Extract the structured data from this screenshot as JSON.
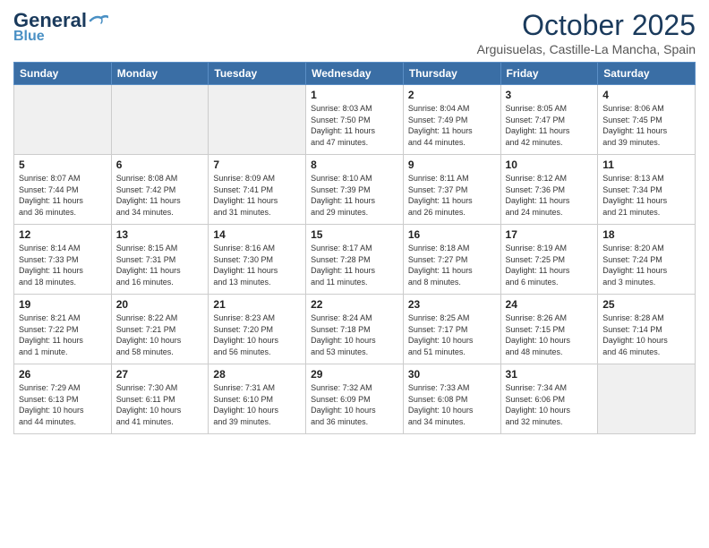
{
  "header": {
    "logo_general": "General",
    "logo_blue": "Blue",
    "month": "October 2025",
    "location": "Arguisuelas, Castille-La Mancha, Spain"
  },
  "days": [
    "Sunday",
    "Monday",
    "Tuesday",
    "Wednesday",
    "Thursday",
    "Friday",
    "Saturday"
  ],
  "weeks": [
    [
      {
        "num": "",
        "text": "",
        "empty": true
      },
      {
        "num": "",
        "text": "",
        "empty": true
      },
      {
        "num": "",
        "text": "",
        "empty": true
      },
      {
        "num": "1",
        "text": "Sunrise: 8:03 AM\nSunset: 7:50 PM\nDaylight: 11 hours\nand 47 minutes."
      },
      {
        "num": "2",
        "text": "Sunrise: 8:04 AM\nSunset: 7:49 PM\nDaylight: 11 hours\nand 44 minutes."
      },
      {
        "num": "3",
        "text": "Sunrise: 8:05 AM\nSunset: 7:47 PM\nDaylight: 11 hours\nand 42 minutes."
      },
      {
        "num": "4",
        "text": "Sunrise: 8:06 AM\nSunset: 7:45 PM\nDaylight: 11 hours\nand 39 minutes."
      }
    ],
    [
      {
        "num": "5",
        "text": "Sunrise: 8:07 AM\nSunset: 7:44 PM\nDaylight: 11 hours\nand 36 minutes."
      },
      {
        "num": "6",
        "text": "Sunrise: 8:08 AM\nSunset: 7:42 PM\nDaylight: 11 hours\nand 34 minutes."
      },
      {
        "num": "7",
        "text": "Sunrise: 8:09 AM\nSunset: 7:41 PM\nDaylight: 11 hours\nand 31 minutes."
      },
      {
        "num": "8",
        "text": "Sunrise: 8:10 AM\nSunset: 7:39 PM\nDaylight: 11 hours\nand 29 minutes."
      },
      {
        "num": "9",
        "text": "Sunrise: 8:11 AM\nSunset: 7:37 PM\nDaylight: 11 hours\nand 26 minutes."
      },
      {
        "num": "10",
        "text": "Sunrise: 8:12 AM\nSunset: 7:36 PM\nDaylight: 11 hours\nand 24 minutes."
      },
      {
        "num": "11",
        "text": "Sunrise: 8:13 AM\nSunset: 7:34 PM\nDaylight: 11 hours\nand 21 minutes."
      }
    ],
    [
      {
        "num": "12",
        "text": "Sunrise: 8:14 AM\nSunset: 7:33 PM\nDaylight: 11 hours\nand 18 minutes."
      },
      {
        "num": "13",
        "text": "Sunrise: 8:15 AM\nSunset: 7:31 PM\nDaylight: 11 hours\nand 16 minutes."
      },
      {
        "num": "14",
        "text": "Sunrise: 8:16 AM\nSunset: 7:30 PM\nDaylight: 11 hours\nand 13 minutes."
      },
      {
        "num": "15",
        "text": "Sunrise: 8:17 AM\nSunset: 7:28 PM\nDaylight: 11 hours\nand 11 minutes."
      },
      {
        "num": "16",
        "text": "Sunrise: 8:18 AM\nSunset: 7:27 PM\nDaylight: 11 hours\nand 8 minutes."
      },
      {
        "num": "17",
        "text": "Sunrise: 8:19 AM\nSunset: 7:25 PM\nDaylight: 11 hours\nand 6 minutes."
      },
      {
        "num": "18",
        "text": "Sunrise: 8:20 AM\nSunset: 7:24 PM\nDaylight: 11 hours\nand 3 minutes."
      }
    ],
    [
      {
        "num": "19",
        "text": "Sunrise: 8:21 AM\nSunset: 7:22 PM\nDaylight: 11 hours\nand 1 minute."
      },
      {
        "num": "20",
        "text": "Sunrise: 8:22 AM\nSunset: 7:21 PM\nDaylight: 10 hours\nand 58 minutes."
      },
      {
        "num": "21",
        "text": "Sunrise: 8:23 AM\nSunset: 7:20 PM\nDaylight: 10 hours\nand 56 minutes."
      },
      {
        "num": "22",
        "text": "Sunrise: 8:24 AM\nSunset: 7:18 PM\nDaylight: 10 hours\nand 53 minutes."
      },
      {
        "num": "23",
        "text": "Sunrise: 8:25 AM\nSunset: 7:17 PM\nDaylight: 10 hours\nand 51 minutes."
      },
      {
        "num": "24",
        "text": "Sunrise: 8:26 AM\nSunset: 7:15 PM\nDaylight: 10 hours\nand 48 minutes."
      },
      {
        "num": "25",
        "text": "Sunrise: 8:28 AM\nSunset: 7:14 PM\nDaylight: 10 hours\nand 46 minutes."
      }
    ],
    [
      {
        "num": "26",
        "text": "Sunrise: 7:29 AM\nSunset: 6:13 PM\nDaylight: 10 hours\nand 44 minutes."
      },
      {
        "num": "27",
        "text": "Sunrise: 7:30 AM\nSunset: 6:11 PM\nDaylight: 10 hours\nand 41 minutes."
      },
      {
        "num": "28",
        "text": "Sunrise: 7:31 AM\nSunset: 6:10 PM\nDaylight: 10 hours\nand 39 minutes."
      },
      {
        "num": "29",
        "text": "Sunrise: 7:32 AM\nSunset: 6:09 PM\nDaylight: 10 hours\nand 36 minutes."
      },
      {
        "num": "30",
        "text": "Sunrise: 7:33 AM\nSunset: 6:08 PM\nDaylight: 10 hours\nand 34 minutes."
      },
      {
        "num": "31",
        "text": "Sunrise: 7:34 AM\nSunset: 6:06 PM\nDaylight: 10 hours\nand 32 minutes."
      },
      {
        "num": "",
        "text": "",
        "empty": true
      }
    ]
  ]
}
